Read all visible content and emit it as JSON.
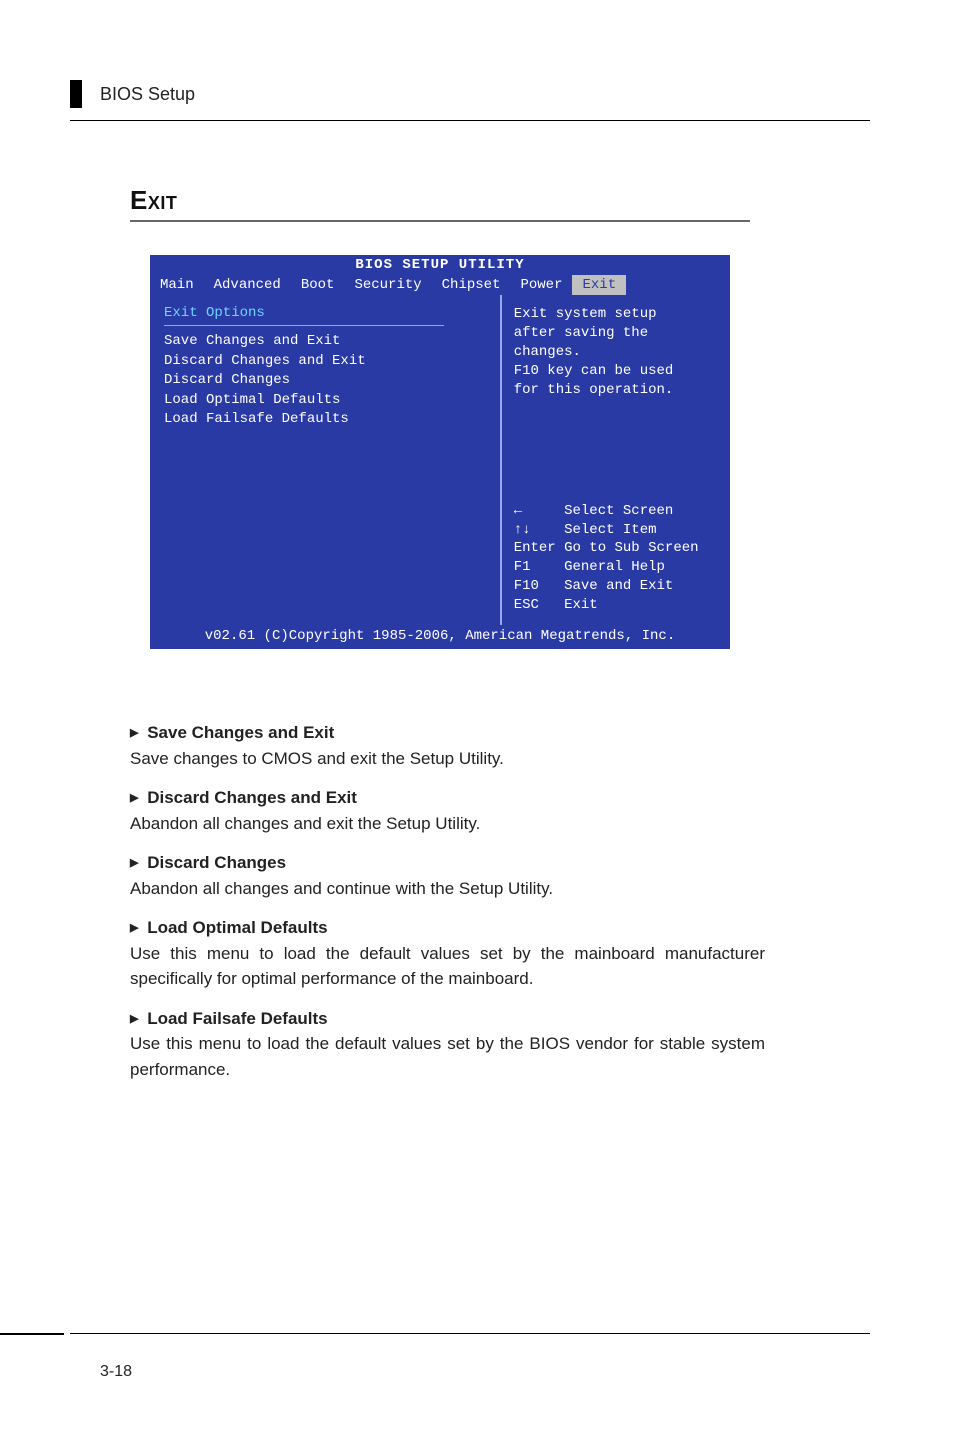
{
  "header": {
    "title": "BIOS Setup"
  },
  "section": {
    "title": "Exit"
  },
  "bios": {
    "title": "BIOS SETUP UTILITY",
    "tabs": [
      "Main",
      "Advanced",
      "Boot",
      "Security",
      "Chipset",
      "Power",
      "Exit"
    ],
    "active_tab_index": 6,
    "left": {
      "group_title": "Exit Options",
      "items": [
        "Save Changes and Exit",
        "Discard Changes and Exit",
        "Discard Changes",
        "",
        "Load Optimal Defaults",
        "Load Failsafe Defaults"
      ]
    },
    "right": {
      "help": [
        "Exit system setup",
        "after saving the",
        "changes.",
        "",
        "F10 key can be used",
        "for this operation."
      ],
      "keys": [
        "←     Select Screen",
        "↑↓    Select Item",
        "Enter Go to Sub Screen",
        "F1    General Help",
        "F10   Save and Exit",
        "ESC   Exit"
      ]
    },
    "footer": "v02.61 (C)Copyright 1985-2006, American Megatrends, Inc."
  },
  "body": {
    "items": [
      {
        "title": "Save Changes and Exit",
        "desc": "Save changes to CMOS and exit the Setup Utility."
      },
      {
        "title": "Discard Changes and Exit",
        "desc": "Abandon all changes and exit the Setup Utility."
      },
      {
        "title": "Discard Changes",
        "desc": "Abandon all changes and continue with the Setup Utility."
      },
      {
        "title": "Load Optimal Defaults",
        "desc": "Use this menu to load the default values set by the mainboard manufacturer specifically for optimal performance of the mainboard."
      },
      {
        "title": "Load Failsafe Defaults",
        "desc": "Use this menu to load the default values set by the BIOS vendor for stable system performance."
      }
    ]
  },
  "footer": {
    "page": "3-18"
  }
}
